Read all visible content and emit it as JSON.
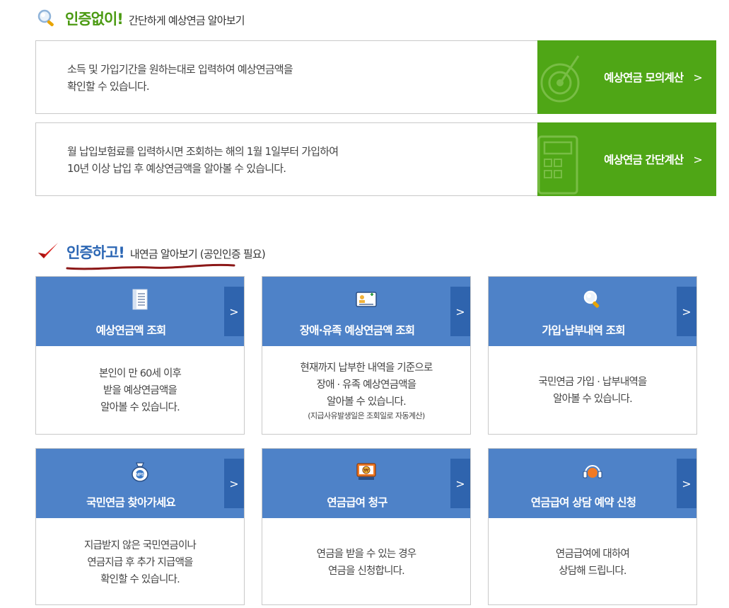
{
  "section1": {
    "highlight": "인증없이!",
    "subtitle": "간단하게 예상연금 알아보기",
    "rows": [
      {
        "desc_line1": "소득 및 가입기간을 원하는대로 입력하여 예상연금액을",
        "desc_line2": "확인할 수 있습니다.",
        "button": "예상연금 모의계산"
      },
      {
        "desc_line1": "월 납입보험료를 입력하시면 조회하는 해의 1월 1일부터 가입하여",
        "desc_line2": "10년 이상 납입 후 예상연금액을 알아볼 수 있습니다.",
        "button": "예상연금 간단계산"
      }
    ],
    "arrow": ">"
  },
  "section2": {
    "highlight": "인증하고!",
    "subtitle": "내연금 알아보기 (공인인증 필요)",
    "cards": [
      {
        "title": "예상연금액 조회",
        "lines": [
          "본인이 만 60세 이후",
          "받을 예상연금액을",
          "알아볼 수 있습니다."
        ]
      },
      {
        "title": "장애·유족 예상연금액 조회",
        "lines": [
          "현재까지 납부한 내역을 기준으로",
          "장애 · 유족 예상연금액을",
          "알아볼 수 있습니다."
        ],
        "note": "(지급사유발생일은 조회일로 자동계산)"
      },
      {
        "title": "가입·납부내역 조회",
        "lines": [
          "국민연금 가입 · 납부내역을",
          "알아볼 수 있습니다."
        ]
      },
      {
        "title": "국민연금 찾아가세요",
        "lines": [
          "지급받지 않은 국민연금이나",
          "연금지급 후 추가 지급액을",
          "확인할 수 있습니다."
        ],
        "icon_badge": "NPS"
      },
      {
        "title": "연금급여 청구",
        "lines": [
          "연금을 받을 수 있는 경우",
          "연금을 신청합니다."
        ],
        "icon_badge": "₩"
      },
      {
        "title": "연금급여 상담 예약 신청",
        "lines": [
          "연금급여에 대하여",
          "상담해 드립니다."
        ]
      }
    ],
    "arrow": ">"
  },
  "colors": {
    "green": "#4fa616",
    "blue_head": "#4e82c8",
    "blue_side": "#2f64ae",
    "title_green": "#4b9a12",
    "title_blue": "#2b66b4"
  }
}
